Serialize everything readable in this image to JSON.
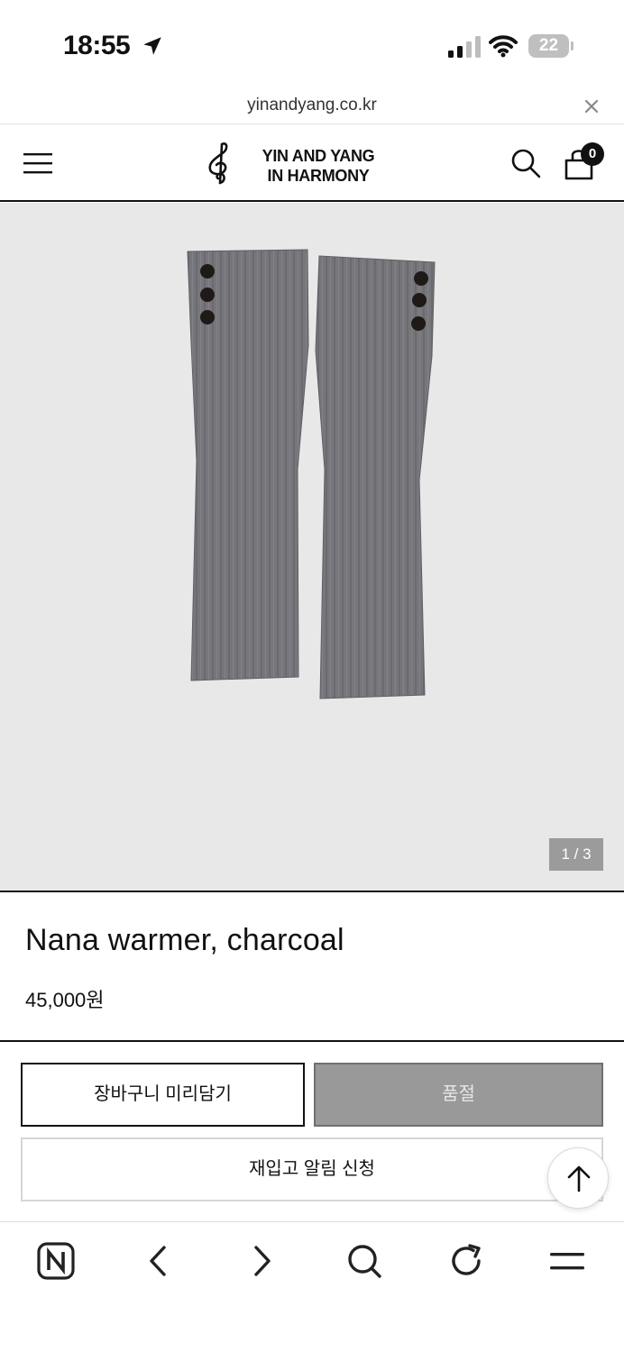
{
  "status_bar": {
    "time": "18:55",
    "battery": "22",
    "icons": [
      "location-arrow-icon",
      "cellular-signal-icon",
      "wifi-icon",
      "battery-icon"
    ]
  },
  "browser": {
    "url": "yinandyang.co.kr",
    "close_icon": "close-icon"
  },
  "header": {
    "logo_line1": "YIN AND YANG",
    "logo_line2": "IN HARMONY",
    "cart_count": "0",
    "icons": [
      "hamburger-menu-icon",
      "treble-clef-logo-icon",
      "search-icon",
      "shopping-bag-icon"
    ]
  },
  "product": {
    "image_description_icon": "product-photo",
    "slide_counter": "1 / 3",
    "title": "Nana warmer, charcoal",
    "price": "45,000원"
  },
  "actions": {
    "cart_button": "장바구니 미리담기",
    "soldout_button": "품절",
    "restock_button": "재입고 알림 신청",
    "scroll_top_icon": "arrow-up-icon"
  },
  "toolbar": {
    "icons": [
      "naver-home-icon",
      "back-icon",
      "forward-icon",
      "search-icon",
      "refresh-icon",
      "menu-icon"
    ]
  },
  "colors": {
    "image_bg": "#e8e8e9",
    "soldout_bg": "#999999",
    "text": "#111111",
    "badge": "#111111"
  }
}
